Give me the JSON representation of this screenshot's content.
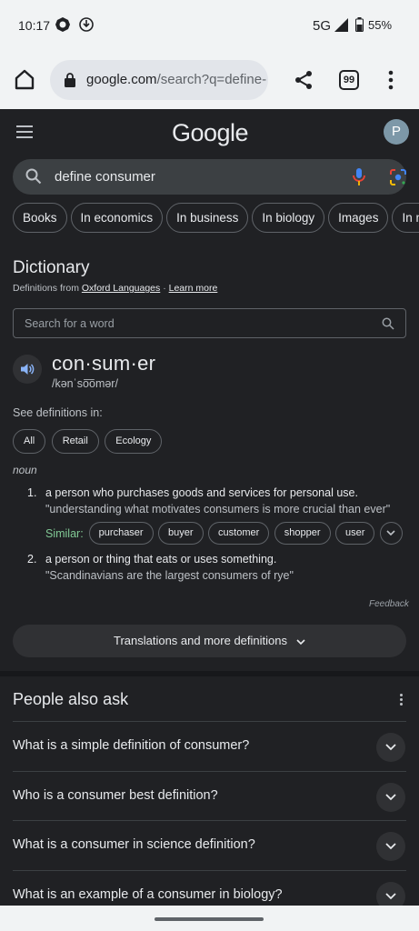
{
  "status_bar": {
    "time": "10:17",
    "network": "5G",
    "battery": "55%"
  },
  "browser": {
    "url_domain": "google.com",
    "url_rest": "/search?q=define-",
    "tab_count": "99"
  },
  "google": {
    "logo": "Google",
    "avatar_letter": "P",
    "query": "define consumer",
    "chips": [
      "Books",
      "In economics",
      "In business",
      "In biology",
      "Images",
      "In m"
    ]
  },
  "dictionary": {
    "title": "Dictionary",
    "source_prefix": "Definitions from",
    "source_name": "Oxford Languages",
    "source_sep": "·",
    "learn_more": "Learn more",
    "search_placeholder": "Search for a word",
    "headword": "con·sum·er",
    "pronunciation": "/kənˈso͞omər/",
    "see_definitions_label": "See definitions in:",
    "definition_filters": [
      "All",
      "Retail",
      "Ecology"
    ],
    "part_of_speech": "noun",
    "senses": [
      {
        "num": "1.",
        "definition": "a person who purchases goods and services for personal use.",
        "example": "\"understanding what motivates consumers is more crucial than ever\""
      },
      {
        "num": "2.",
        "definition": "a person or thing that eats or uses something.",
        "example": "\"Scandinavians are the largest consumers of rye\""
      }
    ],
    "similar_label": "Similar:",
    "similar_words": [
      "purchaser",
      "buyer",
      "customer",
      "shopper",
      "user"
    ],
    "feedback": "Feedback",
    "more_button": "Translations and more definitions"
  },
  "people_also_ask": {
    "title": "People also ask",
    "questions": [
      "What is a simple definition of consumer?",
      "Who is a consumer best definition?",
      "What is a consumer in science definition?",
      "What is an example of a consumer in biology?"
    ]
  },
  "colors": {
    "background": "#202124",
    "chrome": "#f1f3f4",
    "similar_label": "#81c995",
    "mic_blue": "#4285f4"
  }
}
